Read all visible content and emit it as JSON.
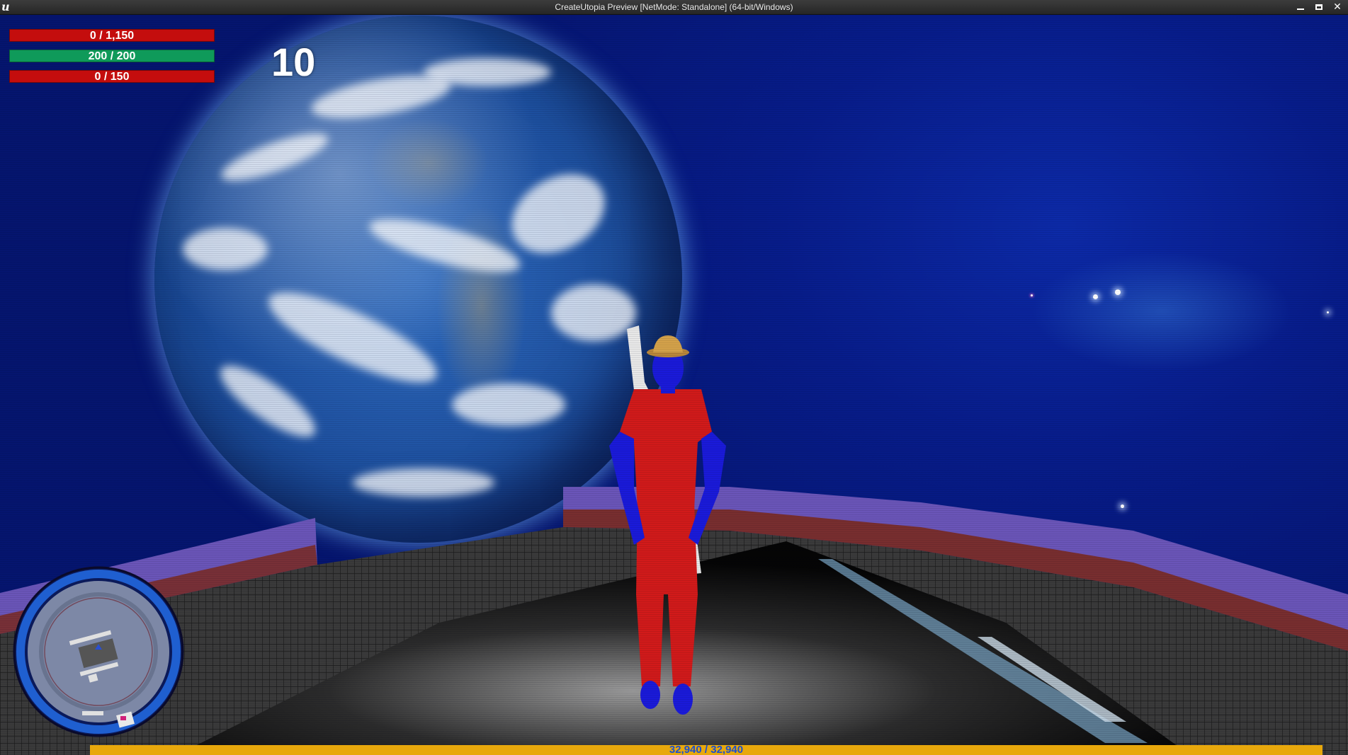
{
  "window": {
    "logo": "u",
    "title": "CreateUtopia Preview [NetMode: Standalone]  (64-bit/Windows)",
    "controls": {
      "minimize": "minimize",
      "maximize": "maximize",
      "close": "✕"
    }
  },
  "hud": {
    "bars": [
      {
        "name": "health",
        "label": "0 / 1,150",
        "value": 0,
        "max": 1150,
        "color": "#c40d0d",
        "empty_color": "#c40d0d"
      },
      {
        "name": "stamina",
        "label": "200 / 200",
        "value": 200,
        "max": 200,
        "color": "#0f9a5a",
        "empty_color": "#0f9a5a"
      },
      {
        "name": "mana",
        "label": "0 / 150",
        "value": 0,
        "max": 150,
        "color": "#c40d0d",
        "empty_color": "#c40d0d"
      }
    ],
    "counter": "10",
    "experience": {
      "label": "32,940 / 32,940",
      "value": 32940,
      "max": 32940,
      "color": "#e8a80c"
    }
  },
  "colors": {
    "sky": "#061a85",
    "platform_floor": "#2a2a2a",
    "railing": "#6a55b8",
    "railing_trim": "#7a2a20",
    "character_body": "#d11a1a",
    "character_skin": "#1a1ad9",
    "hat": "#d4a24a"
  }
}
